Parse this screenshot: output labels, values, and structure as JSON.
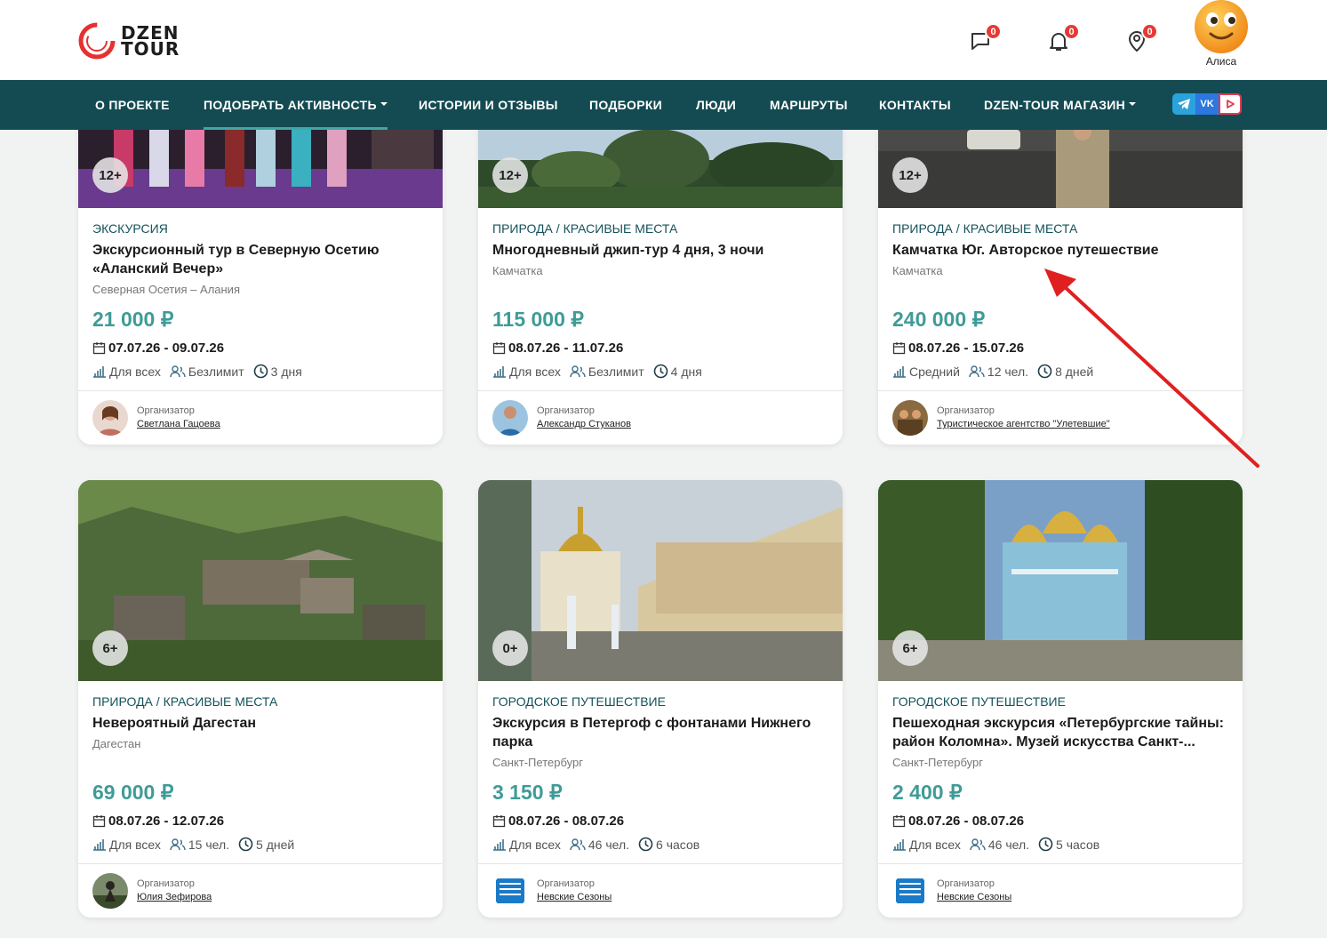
{
  "header": {
    "logo_line1": "DZEN",
    "logo_line2": "TOUR",
    "messages_count": "0",
    "notifications_count": "0",
    "location_count": "0",
    "user_name": "Алиса"
  },
  "nav": {
    "items": [
      {
        "label": "О ПРОЕКТЕ"
      },
      {
        "label": "ПОДОБРАТЬ АКТИВНОСТЬ"
      },
      {
        "label": "ИСТОРИИ И ОТЗЫВЫ"
      },
      {
        "label": "ПОДБОРКИ"
      },
      {
        "label": "ЛЮДИ"
      },
      {
        "label": "МАРШРУТЫ"
      },
      {
        "label": "КОНТАКТЫ"
      },
      {
        "label": "DZEN-TOUR МАГАЗИН"
      }
    ],
    "social": [
      "telegram-icon",
      "vk-icon",
      "rutube-icon"
    ]
  },
  "organizer_label": "Организатор",
  "cards": [
    {
      "age": "12+",
      "category": "ЭКСКУРСИЯ",
      "title": "Экскурсионный тур в Северную Осетию «Аланский Вечер»",
      "location": "Северная Осетия – Алания",
      "price": "21 000 ₽",
      "dates": "07.07.26 - 09.07.26",
      "level": "Для всех",
      "group": "Безлимит",
      "duration": "3 дня",
      "organizer": "Светлана Гацоева"
    },
    {
      "age": "12+",
      "category": "ПРИРОДА / КРАСИВЫЕ МЕСТА",
      "title": "Многодневный джип-тур 4 дня, 3 ночи",
      "location": "Камчатка",
      "price": "115 000 ₽",
      "dates": "08.07.26 - 11.07.26",
      "level": "Для всех",
      "group": "Безлимит",
      "duration": "4 дня",
      "organizer": "Александр Стуканов"
    },
    {
      "age": "12+",
      "category": "ПРИРОДА / КРАСИВЫЕ МЕСТА",
      "title": "Камчатка Юг. Авторское путешествие",
      "location": "Камчатка",
      "price": "240 000 ₽",
      "dates": "08.07.26 - 15.07.26",
      "level": "Средний",
      "group": "12 чел.",
      "duration": "8 дней",
      "organizer": "Туристическое агентство \"Улетевшие\""
    },
    {
      "age": "6+",
      "category": "ПРИРОДА / КРАСИВЫЕ МЕСТА",
      "title": "Невероятный Дагестан",
      "location": "Дагестан",
      "price": "69 000 ₽",
      "dates": "08.07.26 - 12.07.26",
      "level": "Для всех",
      "group": "15 чел.",
      "duration": "5 дней",
      "organizer": "Юлия Зефирова"
    },
    {
      "age": "0+",
      "category": "ГОРОДСКОЕ ПУТЕШЕСТВИЕ",
      "title": "Экскурсия в Петергоф с фонтанами Нижнего парка",
      "location": "Санкт-Петербург",
      "price": "3 150 ₽",
      "dates": "08.07.26 - 08.07.26",
      "level": "Для всех",
      "group": "46 чел.",
      "duration": "6 часов",
      "organizer": "Невские Сезоны"
    },
    {
      "age": "6+",
      "category": "ГОРОДСКОЕ ПУТЕШЕСТВИЕ",
      "title": "Пешеходная экскурсия «Петербургские тайны: район Коломна». Музей искусства Санкт-...",
      "location": "Санкт-Петербург",
      "price": "2 400 ₽",
      "dates": "08.07.26 - 08.07.26",
      "level": "Для всех",
      "group": "46 чел.",
      "duration": "5 часов",
      "organizer": "Невские Сезоны"
    }
  ],
  "colors": {
    "nav_bg": "#144b52",
    "accent": "#3fa8a3",
    "price": "#3f9b97",
    "badge": "#e53935",
    "arrow": "#e02020"
  }
}
